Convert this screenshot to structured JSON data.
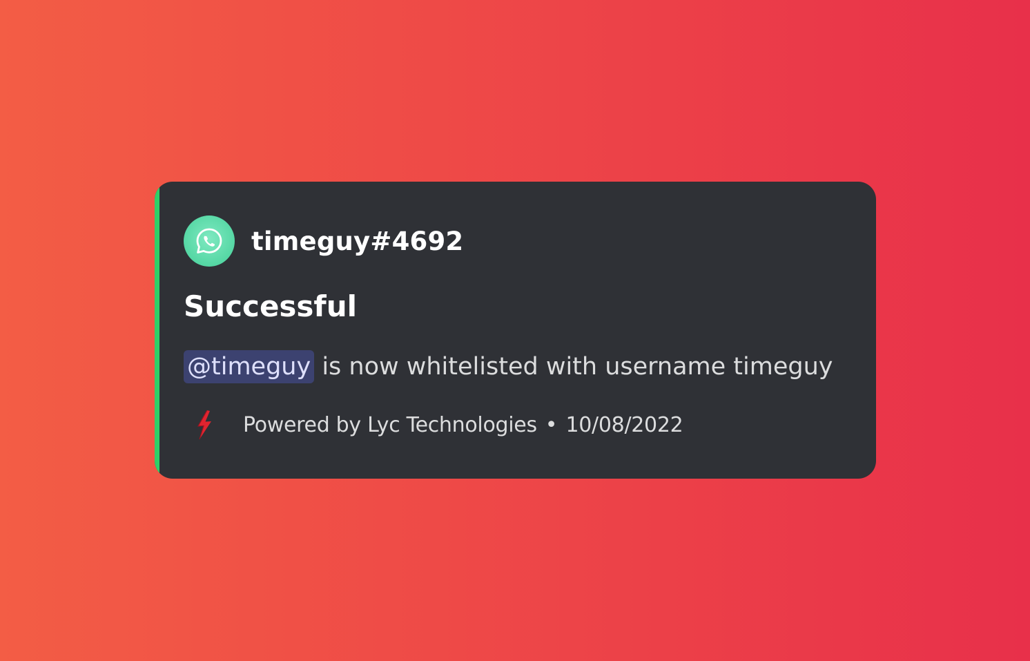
{
  "colors": {
    "background_left": "#f35d45",
    "background_right": "#e8304a",
    "embed_background": "#2f3136",
    "accent_bar": "#2fd068",
    "mention_bg": "#3c4270",
    "footer_icon": "#e0242f"
  },
  "embed": {
    "author": {
      "name": "timeguy#4692",
      "avatar_icon": "whatsapp-icon"
    },
    "title": "Successful",
    "description": {
      "mention": "@timeguy",
      "text": " is now whitelisted with username timeguy"
    },
    "footer": {
      "icon": "lightning-bolt-icon",
      "text": "Powered by Lyc Technologies",
      "separator": "•",
      "timestamp": "10/08/2022"
    }
  }
}
